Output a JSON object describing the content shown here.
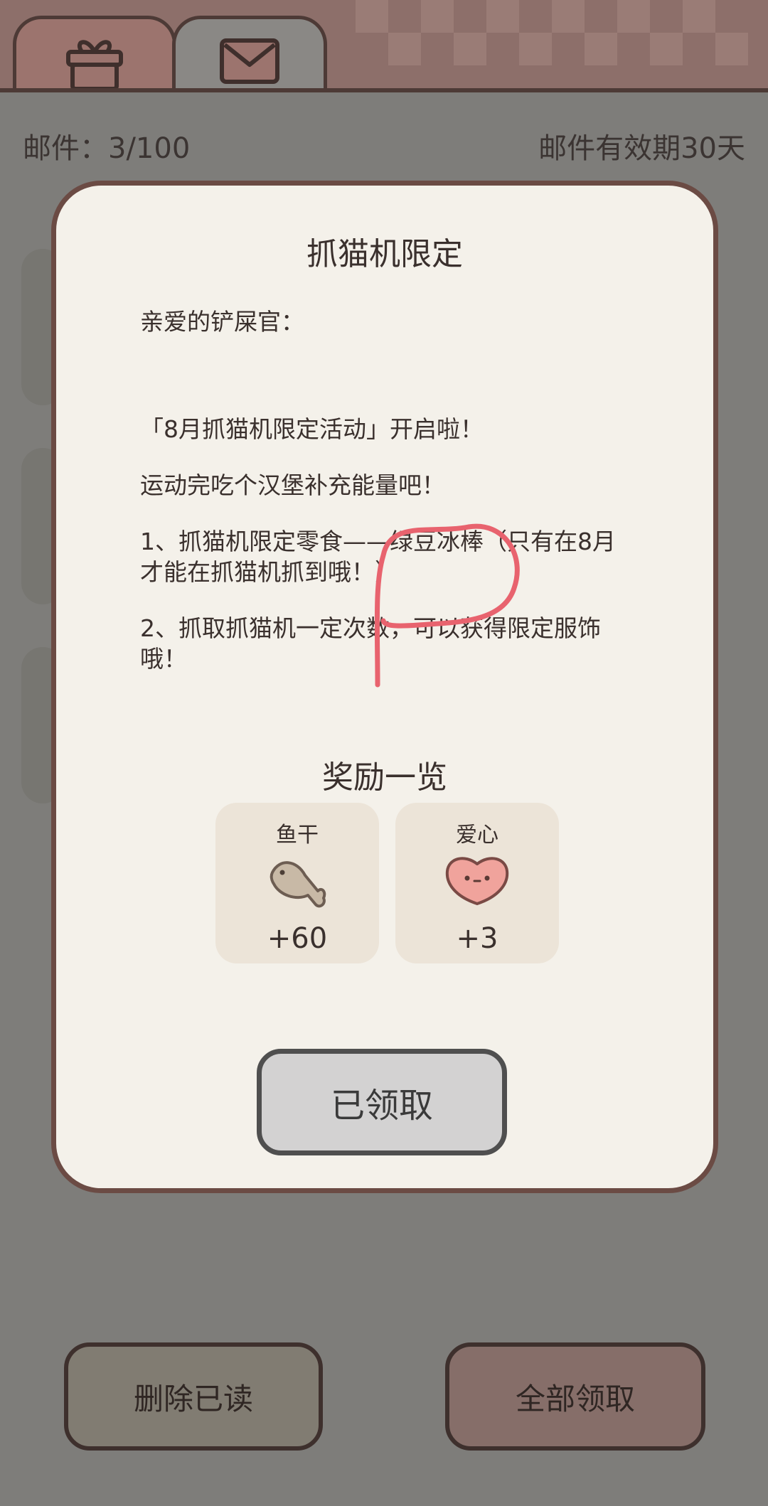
{
  "tabs": [
    {
      "icon": "gift-icon",
      "active": false
    },
    {
      "icon": "mail-icon",
      "active": true
    }
  ],
  "header": {
    "mail_count": "邮件：3/100",
    "validity": "邮件有效期30天"
  },
  "modal": {
    "title": "抓猫机限定",
    "letter": {
      "greeting": "亲爱的铲屎官：",
      "line1": "「8月抓猫机限定活动」开启啦！",
      "line2": "运动完吃个汉堡补充能量吧！",
      "item1": "1、抓猫机限定零食——绿豆冰棒（只有在8月才能在抓猫机抓到哦！）",
      "item2": "2、抓取抓猫机一定次数，可以获得限定服饰哦！"
    },
    "rewards_title": "奖励一览",
    "rewards": [
      {
        "name": "鱼干",
        "value": "+60",
        "icon": "fish-icon"
      },
      {
        "name": "爱心",
        "value": "+3",
        "icon": "heart-icon"
      }
    ],
    "claimed_label": "已领取"
  },
  "footer": {
    "delete_read_label": "删除已读",
    "claim_all_label": "全部领取"
  },
  "colors": {
    "overlay": "#7e7d7a",
    "modal_bg": "#f4f1ea",
    "modal_border": "#6b4b44",
    "annotation": "#e8636e"
  }
}
